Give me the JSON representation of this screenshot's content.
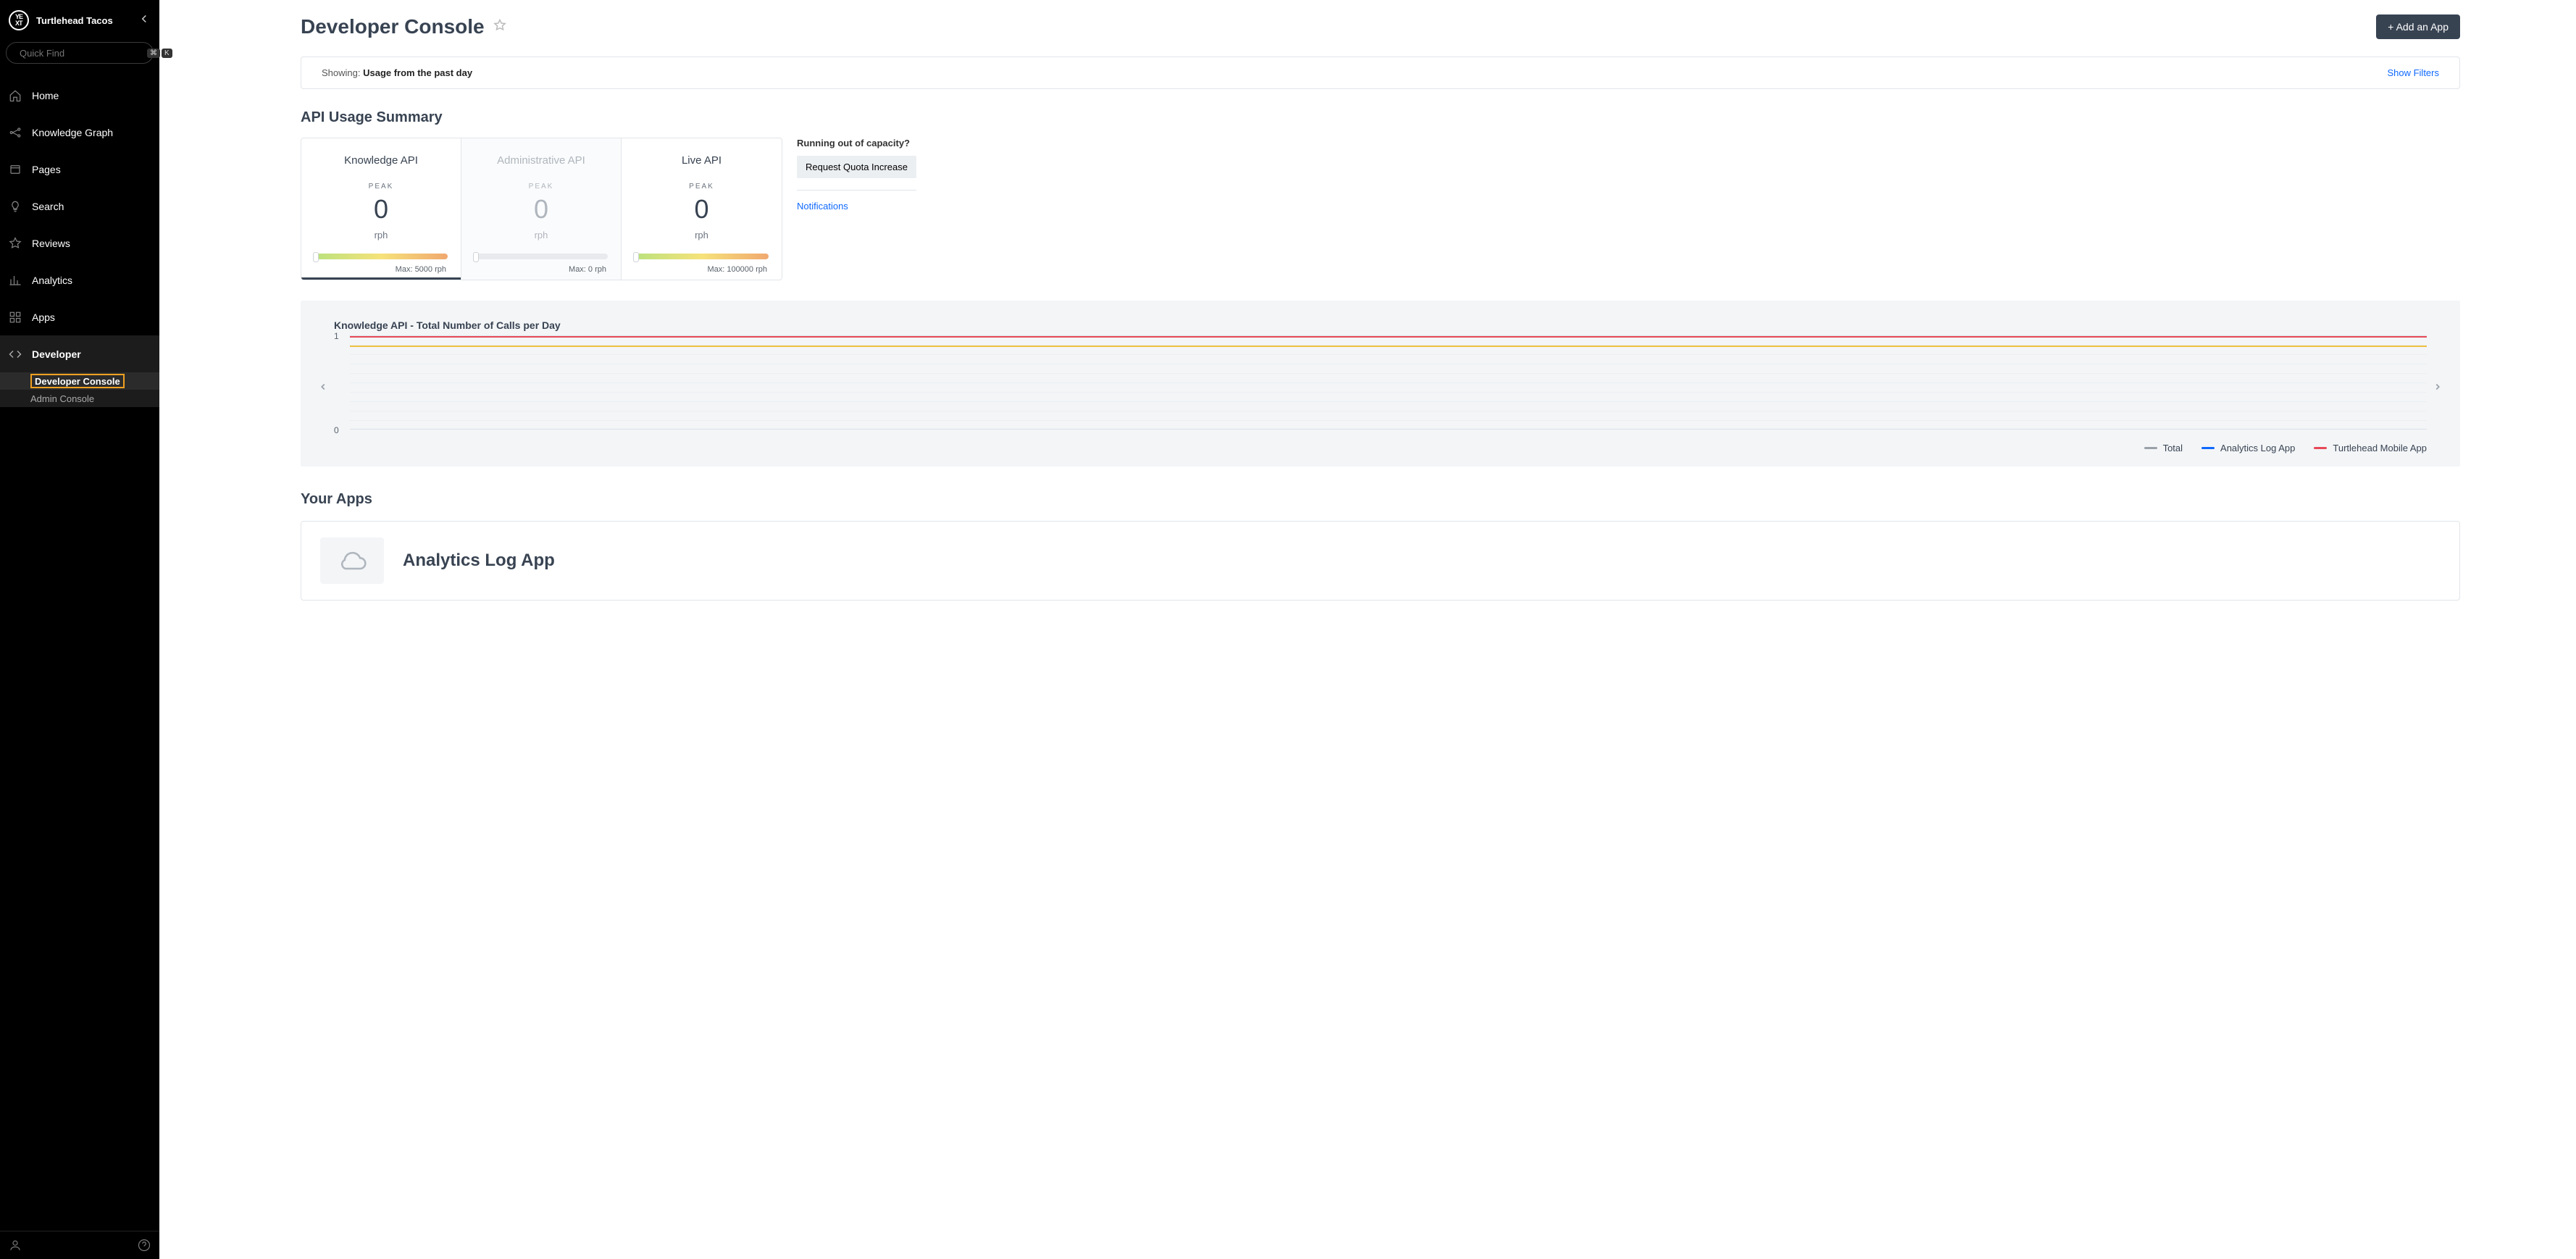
{
  "org_name": "Turtlehead Tacos",
  "quickfind_placeholder": "Quick Find",
  "kbd_keys": [
    "⌘",
    "K"
  ],
  "nav": {
    "home": "Home",
    "kg": "Knowledge Graph",
    "pages": "Pages",
    "search": "Search",
    "reviews": "Reviews",
    "analytics": "Analytics",
    "apps": "Apps",
    "developer": "Developer"
  },
  "subnav": {
    "devconsole": "Developer Console",
    "adminconsole": "Admin Console"
  },
  "page_title": "Developer Console",
  "add_btn": "+ Add an App",
  "filter": {
    "showing_lbl": "Showing: ",
    "showing_val": "Usage from the past day",
    "show_filters": "Show Filters"
  },
  "section_api_usage": "API Usage Summary",
  "cards": {
    "knowledge": {
      "title": "Knowledge API",
      "peak": "PEAK",
      "value": "0",
      "unit": "rph",
      "max": "Max: 5000 rph"
    },
    "admin": {
      "title": "Administrative API",
      "peak": "PEAK",
      "value": "0",
      "unit": "rph",
      "max": "Max: 0 rph"
    },
    "live": {
      "title": "Live API",
      "peak": "PEAK",
      "value": "0",
      "unit": "rph",
      "max": "Max: 100000 rph"
    }
  },
  "side": {
    "running_out": "Running out of capacity?",
    "quota_btn": "Request Quota Increase",
    "notifications": "Notifications"
  },
  "chart_data": {
    "type": "line",
    "title": "Knowledge API - Total Number of Calls per Day",
    "ylim": [
      0,
      1
    ],
    "y_ticks": [
      "1",
      "0"
    ],
    "series": [
      {
        "name": "Total",
        "color": "#9aa1a9",
        "values": []
      },
      {
        "name": "Analytics Log App",
        "color": "#0f69ff",
        "values": []
      },
      {
        "name": "Turtlehead Mobile App",
        "color": "#e74856",
        "values": []
      }
    ],
    "threshold_lines": [
      {
        "y": 1,
        "color": "#e74856"
      },
      {
        "y": 0.9,
        "color": "#f0c040"
      }
    ]
  },
  "your_apps_heading": "Your Apps",
  "apps": [
    {
      "name": "Analytics Log App"
    }
  ]
}
